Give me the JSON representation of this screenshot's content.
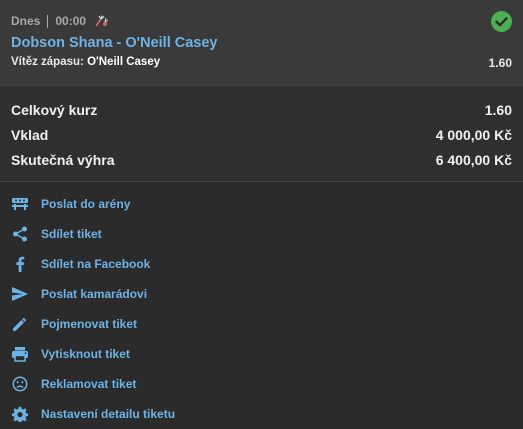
{
  "ticket": {
    "date_label": "Dnes",
    "time": "00:00",
    "sport_icon": "badminton-icon",
    "status_icon": "check-circle-icon",
    "status_color": "#4caf50",
    "match": "Dobson Shana - O'Neill Casey",
    "market_label": "Vítěz zápasu:",
    "pick": "O'Neill Casey",
    "odds": "1.60"
  },
  "summary": {
    "total_odds_label": "Celkový kurz",
    "total_odds_value": "1.60",
    "stake_label": "Vklad",
    "stake_value": "4 000,00 Kč",
    "payout_label": "Skutečná výhra",
    "payout_value": "6 400,00 Kč"
  },
  "actions": [
    {
      "label": "Poslat do arény",
      "icon": "arena-icon"
    },
    {
      "label": "Sdílet tiket",
      "icon": "share-icon"
    },
    {
      "label": "Sdílet na Facebook",
      "icon": "facebook-icon"
    },
    {
      "label": "Poslat kamarádovi",
      "icon": "send-icon"
    },
    {
      "label": "Pojmenovat tiket",
      "icon": "pencil-icon"
    },
    {
      "label": "Vytisknout tiket",
      "icon": "print-icon"
    },
    {
      "label": "Reklamovat tiket",
      "icon": "sad-face-icon"
    },
    {
      "label": "Nastavení detailu tiketu",
      "icon": "gear-icon"
    }
  ],
  "colors": {
    "accent_link": "#6eb3e6",
    "success": "#4caf50"
  }
}
